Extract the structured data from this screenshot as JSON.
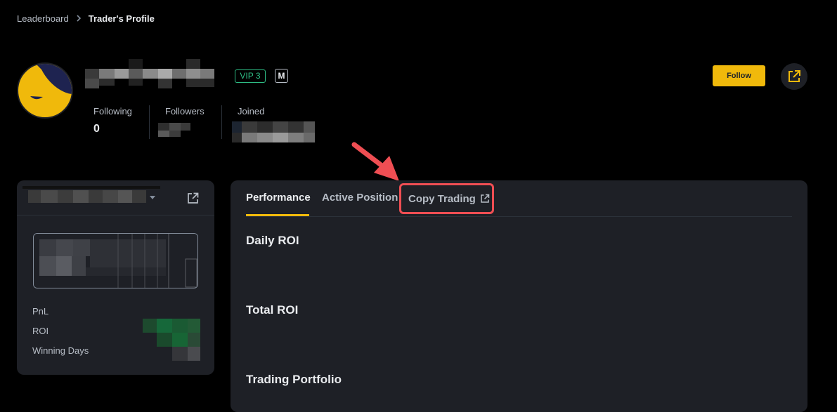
{
  "breadcrumb": {
    "parent": "Leaderboard",
    "current": "Trader's Profile"
  },
  "profile": {
    "vip_badge": "VIP 3",
    "m_badge": "M",
    "stats": [
      {
        "label": "Following",
        "value": "0"
      },
      {
        "label": "Followers",
        "value": ""
      },
      {
        "label": "Joined",
        "value": ""
      }
    ],
    "follow_label": "Follow"
  },
  "left_card": {
    "metrics": [
      "PnL",
      "ROI",
      "Winning Days"
    ]
  },
  "right_card": {
    "tabs": [
      {
        "label": "Performance"
      },
      {
        "label": "Active Position"
      },
      {
        "label": "Copy Trading"
      }
    ],
    "sections": [
      "Daily ROI",
      "Total ROI",
      "Trading Portfolio"
    ]
  },
  "colors": {
    "accent": "#f0b90b",
    "highlight": "#ef4e53",
    "vip": "#2ebd85",
    "background": "#000000",
    "card": "#1e2026"
  },
  "icons": {
    "breadcrumb_separator": "chevron-right-icon",
    "share": "external-link-icon",
    "annotation": "red-arrow"
  }
}
